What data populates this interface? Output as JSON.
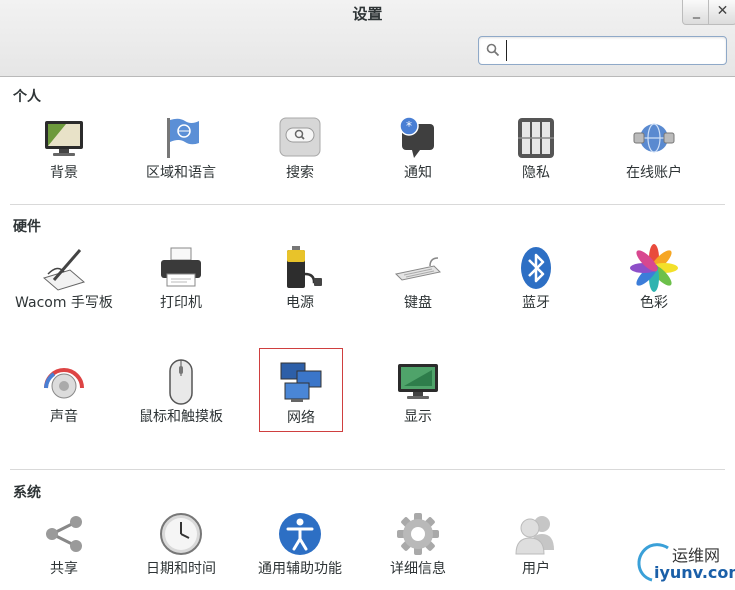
{
  "window": {
    "title": "设置",
    "minimize_glyph": "_",
    "close_glyph": "✕"
  },
  "search": {
    "value": "",
    "placeholder": "",
    "icon": "search-icon"
  },
  "sections": [
    {
      "title": "个人",
      "items": [
        {
          "label": "背景",
          "icon": "background-icon"
        },
        {
          "label": "区域和语言",
          "icon": "flag-icon"
        },
        {
          "label": "搜索",
          "icon": "search-icon"
        },
        {
          "label": "通知",
          "icon": "notification-icon"
        },
        {
          "label": "隐私",
          "icon": "privacy-icon"
        },
        {
          "label": "在线账户",
          "icon": "online-accounts-icon"
        }
      ]
    },
    {
      "title": "硬件",
      "items": [
        {
          "label": "Wacom 手写板",
          "icon": "tablet-icon"
        },
        {
          "label": "打印机",
          "icon": "printer-icon"
        },
        {
          "label": "电源",
          "icon": "battery-icon"
        },
        {
          "label": "键盘",
          "icon": "keyboard-icon"
        },
        {
          "label": "蓝牙",
          "icon": "bluetooth-icon"
        },
        {
          "label": "色彩",
          "icon": "color-icon"
        },
        {
          "label": "声音",
          "icon": "sound-icon"
        },
        {
          "label": "鼠标和触摸板",
          "icon": "mouse-icon"
        },
        {
          "label": "网络",
          "icon": "network-icon",
          "selected": true
        },
        {
          "label": "显示",
          "icon": "display-icon"
        }
      ]
    },
    {
      "title": "系统",
      "items": [
        {
          "label": "共享",
          "icon": "share-icon"
        },
        {
          "label": "日期和时间",
          "icon": "clock-icon"
        },
        {
          "label": "通用辅助功能",
          "icon": "accessibility-icon"
        },
        {
          "label": "详细信息",
          "icon": "gear-icon"
        },
        {
          "label": "用户",
          "icon": "users-icon"
        }
      ]
    }
  ],
  "watermark": {
    "line1": "运维网",
    "line2": "iyunv.com"
  },
  "colors": {
    "selection_border": "#cf3f3f",
    "search_border": "#8fa9c8"
  }
}
